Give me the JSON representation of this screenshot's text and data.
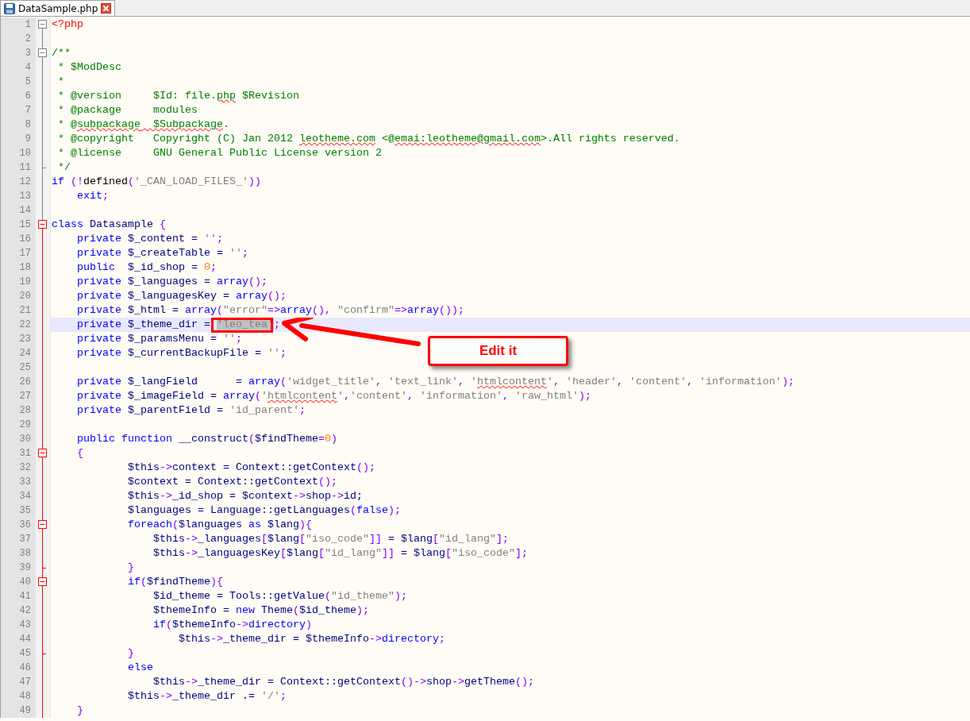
{
  "tabs": [
    {
      "label": "DataSample.php",
      "selected": true
    }
  ],
  "lines": [
    {
      "number": "1",
      "collapsible": true,
      "block_end": false,
      "active_block": false,
      "current": false,
      "tokens": [
        {
          "kind": "tag",
          "text": "<?php"
        }
      ]
    },
    {
      "number": "2",
      "collapsible": false,
      "block_end": false,
      "active_block": false,
      "current": false
    },
    {
      "number": "3",
      "collapsible": true,
      "block_end": false,
      "active_block": false,
      "current": false,
      "tokens": [
        {
          "kind": "comment",
          "text": "/**"
        }
      ]
    },
    {
      "number": "4",
      "collapsible": false,
      "block_end": false,
      "active_block": false,
      "current": false,
      "tokens": [
        {
          "kind": "comment",
          "text": " * $ModDesc"
        }
      ]
    },
    {
      "number": "5",
      "collapsible": false,
      "block_end": false,
      "active_block": false,
      "current": false,
      "tokens": [
        {
          "kind": "comment",
          "text": " *"
        }
      ]
    },
    {
      "number": "6",
      "collapsible": false,
      "block_end": false,
      "active_block": false,
      "current": false,
      "tokens": [
        {
          "kind": "comment",
          "text": " * @version     $Id: file."
        },
        {
          "kind": "comment-typo",
          "text": "php"
        },
        {
          "kind": "comment",
          "text": " $Revision"
        }
      ]
    },
    {
      "number": "7",
      "collapsible": false,
      "block_end": false,
      "active_block": false,
      "current": false,
      "tokens": [
        {
          "kind": "comment",
          "text": " * @package     modules"
        }
      ]
    },
    {
      "number": "8",
      "collapsible": false,
      "block_end": false,
      "active_block": false,
      "current": false,
      "tokens": [
        {
          "kind": "comment",
          "text": " * @"
        },
        {
          "kind": "comment-typo",
          "text": "subpackage"
        },
        {
          "kind": "comment-typo",
          "text": "  $Subpackage"
        },
        {
          "kind": "comment",
          "text": "."
        }
      ]
    },
    {
      "number": "9",
      "collapsible": false,
      "block_end": false,
      "active_block": false,
      "current": false,
      "tokens": [
        {
          "kind": "comment",
          "text": " * @copyright   Copyright (C) Jan 2012 "
        },
        {
          "kind": "comment-typo",
          "text": "leotheme.com"
        },
        {
          "kind": "comment",
          "text": " <@"
        },
        {
          "kind": "comment-typo",
          "text": "emai:leotheme@gmail.com"
        },
        {
          "kind": "comment",
          "text": ">.All rights reserved."
        }
      ]
    },
    {
      "number": "10",
      "collapsible": false,
      "block_end": false,
      "active_block": false,
      "current": false,
      "tokens": [
        {
          "kind": "comment",
          "text": " * @license     GNU General Public License version 2"
        }
      ]
    },
    {
      "number": "11",
      "collapsible": false,
      "block_end": true,
      "active_block": false,
      "current": false,
      "tokens": [
        {
          "kind": "comment",
          "text": " */"
        }
      ]
    },
    {
      "number": "12",
      "collapsible": false,
      "block_end": false,
      "active_block": false,
      "current": false,
      "tokens": [
        {
          "kind": "kw",
          "text": "if"
        },
        {
          "kind": "op",
          "text": " (!"
        },
        {
          "kind": "plain",
          "text": "defined"
        },
        {
          "kind": "op",
          "text": "("
        },
        {
          "kind": "str",
          "text": "'_CAN_LOAD_FILES_'"
        },
        {
          "kind": "op",
          "text": "))"
        }
      ]
    },
    {
      "number": "13",
      "collapsible": false,
      "block_end": false,
      "active_block": false,
      "current": false,
      "tokens": [
        {
          "kind": "kw",
          "text": "    exit"
        },
        {
          "kind": "op",
          "text": ";"
        }
      ]
    },
    {
      "number": "14",
      "collapsible": false,
      "block_end": false,
      "active_block": false,
      "current": false
    },
    {
      "number": "15",
      "collapsible": true,
      "block_end": false,
      "active_block": true,
      "current": false,
      "tokens": [
        {
          "kind": "kw",
          "text": "class"
        },
        {
          "kind": "var",
          "text": " Datasample "
        },
        {
          "kind": "op",
          "text": "{"
        }
      ]
    },
    {
      "number": "16",
      "collapsible": false,
      "block_end": false,
      "active_block": true,
      "current": false,
      "tokens": [
        {
          "kind": "kw",
          "text": "    private"
        },
        {
          "kind": "var",
          "text": " $_content = "
        },
        {
          "kind": "str",
          "text": "''"
        },
        {
          "kind": "op",
          "text": ";"
        }
      ]
    },
    {
      "number": "17",
      "collapsible": false,
      "block_end": false,
      "active_block": true,
      "current": false,
      "tokens": [
        {
          "kind": "kw",
          "text": "    private"
        },
        {
          "kind": "var",
          "text": " $_createTable = "
        },
        {
          "kind": "str",
          "text": "''"
        },
        {
          "kind": "op",
          "text": ";"
        }
      ]
    },
    {
      "number": "18",
      "collapsible": false,
      "block_end": false,
      "active_block": true,
      "current": false,
      "tokens": [
        {
          "kind": "kw",
          "text": "    public"
        },
        {
          "kind": "var",
          "text": "  $_id_shop = "
        },
        {
          "kind": "num",
          "text": "0"
        },
        {
          "kind": "op",
          "text": ";"
        }
      ]
    },
    {
      "number": "19",
      "collapsible": false,
      "block_end": false,
      "active_block": true,
      "current": false,
      "tokens": [
        {
          "kind": "kw",
          "text": "    private"
        },
        {
          "kind": "var",
          "text": " $_languages = "
        },
        {
          "kind": "kw",
          "text": "array"
        },
        {
          "kind": "op",
          "text": "();"
        }
      ]
    },
    {
      "number": "20",
      "collapsible": false,
      "block_end": false,
      "active_block": true,
      "current": false,
      "tokens": [
        {
          "kind": "kw",
          "text": "    private"
        },
        {
          "kind": "var",
          "text": " $_languagesKey = "
        },
        {
          "kind": "kw",
          "text": "array"
        },
        {
          "kind": "op",
          "text": "();"
        }
      ]
    },
    {
      "number": "21",
      "collapsible": false,
      "block_end": false,
      "active_block": true,
      "current": false,
      "tokens": [
        {
          "kind": "kw",
          "text": "    private"
        },
        {
          "kind": "var",
          "text": " $_html = "
        },
        {
          "kind": "kw",
          "text": "array"
        },
        {
          "kind": "op",
          "text": "("
        },
        {
          "kind": "str",
          "text": "\"error\""
        },
        {
          "kind": "op",
          "text": "=>"
        },
        {
          "kind": "kw",
          "text": "array"
        },
        {
          "kind": "op",
          "text": "(), "
        },
        {
          "kind": "str",
          "text": "\"confirm\""
        },
        {
          "kind": "op",
          "text": "=>"
        },
        {
          "kind": "kw",
          "text": "array"
        },
        {
          "kind": "op",
          "text": "());"
        }
      ]
    },
    {
      "number": "22",
      "collapsible": false,
      "block_end": false,
      "active_block": true,
      "current": true,
      "tokens": [
        {
          "kind": "kw",
          "text": "    private"
        },
        {
          "kind": "var",
          "text": " $_theme_dir = "
        },
        {
          "kind": "str-selected",
          "text": "'leo_tea'"
        },
        {
          "kind": "op",
          "text": ";"
        }
      ]
    },
    {
      "number": "23",
      "collapsible": false,
      "block_end": false,
      "active_block": true,
      "current": false,
      "tokens": [
        {
          "kind": "kw",
          "text": "    private"
        },
        {
          "kind": "var",
          "text": " $_paramsMenu = "
        },
        {
          "kind": "str",
          "text": "''"
        },
        {
          "kind": "op",
          "text": ";"
        }
      ]
    },
    {
      "number": "24",
      "collapsible": false,
      "block_end": false,
      "active_block": true,
      "current": false,
      "tokens": [
        {
          "kind": "kw",
          "text": "    private"
        },
        {
          "kind": "var",
          "text": " $_currentBackupFile = "
        },
        {
          "kind": "str",
          "text": "''"
        },
        {
          "kind": "op",
          "text": ";"
        }
      ]
    },
    {
      "number": "25",
      "collapsible": false,
      "block_end": false,
      "active_block": true,
      "current": false
    },
    {
      "number": "26",
      "collapsible": false,
      "block_end": false,
      "active_block": true,
      "current": false,
      "tokens": [
        {
          "kind": "kw",
          "text": "    private"
        },
        {
          "kind": "var",
          "text": " $_langField      = "
        },
        {
          "kind": "kw",
          "text": "array"
        },
        {
          "kind": "op",
          "text": "("
        },
        {
          "kind": "str",
          "text": "'widget_title'"
        },
        {
          "kind": "op",
          "text": ", "
        },
        {
          "kind": "str",
          "text": "'text_link'"
        },
        {
          "kind": "op",
          "text": ", "
        },
        {
          "kind": "str",
          "text": "'"
        },
        {
          "kind": "str-typo",
          "text": "htmlcontent"
        },
        {
          "kind": "str",
          "text": "'"
        },
        {
          "kind": "op",
          "text": ", "
        },
        {
          "kind": "str",
          "text": "'header'"
        },
        {
          "kind": "op",
          "text": ", "
        },
        {
          "kind": "str",
          "text": "'content'"
        },
        {
          "kind": "op",
          "text": ", "
        },
        {
          "kind": "str",
          "text": "'information'"
        },
        {
          "kind": "op",
          "text": ");"
        }
      ]
    },
    {
      "number": "27",
      "collapsible": false,
      "block_end": false,
      "active_block": true,
      "current": false,
      "tokens": [
        {
          "kind": "kw",
          "text": "    private"
        },
        {
          "kind": "var",
          "text": " $_imageField = "
        },
        {
          "kind": "kw",
          "text": "array"
        },
        {
          "kind": "op",
          "text": "("
        },
        {
          "kind": "str",
          "text": "'"
        },
        {
          "kind": "str-typo",
          "text": "htmlcontent"
        },
        {
          "kind": "str",
          "text": "'"
        },
        {
          "kind": "op",
          "text": ","
        },
        {
          "kind": "str",
          "text": "'content'"
        },
        {
          "kind": "op",
          "text": ", "
        },
        {
          "kind": "str",
          "text": "'information'"
        },
        {
          "kind": "op",
          "text": ", "
        },
        {
          "kind": "str",
          "text": "'raw_html'"
        },
        {
          "kind": "op",
          "text": ");"
        }
      ]
    },
    {
      "number": "28",
      "collapsible": false,
      "block_end": false,
      "active_block": true,
      "current": false,
      "tokens": [
        {
          "kind": "kw",
          "text": "    private"
        },
        {
          "kind": "var",
          "text": " $_parentField = "
        },
        {
          "kind": "str",
          "text": "'id_parent'"
        },
        {
          "kind": "op",
          "text": ";"
        }
      ]
    },
    {
      "number": "29",
      "collapsible": false,
      "block_end": false,
      "active_block": true,
      "current": false
    },
    {
      "number": "30",
      "collapsible": false,
      "block_end": false,
      "active_block": true,
      "current": false,
      "tokens": [
        {
          "kind": "kw",
          "text": "    public function"
        },
        {
          "kind": "var",
          "text": " __construct"
        },
        {
          "kind": "op",
          "text": "("
        },
        {
          "kind": "var",
          "text": "$findTheme"
        },
        {
          "kind": "op",
          "text": "="
        },
        {
          "kind": "num",
          "text": "0"
        },
        {
          "kind": "op",
          "text": ")"
        }
      ]
    },
    {
      "number": "31",
      "collapsible": true,
      "block_end": false,
      "active_block": true,
      "current": false,
      "tokens": [
        {
          "kind": "op",
          "text": "    {"
        }
      ]
    },
    {
      "number": "32",
      "collapsible": false,
      "block_end": false,
      "active_block": true,
      "current": false,
      "tokens": [
        {
          "kind": "var",
          "text": "            $this"
        },
        {
          "kind": "op",
          "text": "->"
        },
        {
          "kind": "var",
          "text": "context = Context::getContext"
        },
        {
          "kind": "op",
          "text": "();"
        }
      ]
    },
    {
      "number": "33",
      "collapsible": false,
      "block_end": false,
      "active_block": true,
      "current": false,
      "tokens": [
        {
          "kind": "var",
          "text": "            $context = Context::getContext"
        },
        {
          "kind": "op",
          "text": "();"
        }
      ]
    },
    {
      "number": "34",
      "collapsible": false,
      "block_end": false,
      "active_block": true,
      "current": false,
      "tokens": [
        {
          "kind": "var",
          "text": "            $this"
        },
        {
          "kind": "op",
          "text": "->"
        },
        {
          "kind": "var",
          "text": "_id_shop = $context"
        },
        {
          "kind": "op",
          "text": "->"
        },
        {
          "kind": "var",
          "text": "shop"
        },
        {
          "kind": "op",
          "text": "->"
        },
        {
          "kind": "var",
          "text": "id;"
        }
      ]
    },
    {
      "number": "35",
      "collapsible": false,
      "block_end": false,
      "active_block": true,
      "current": false,
      "tokens": [
        {
          "kind": "var",
          "text": "            $languages = Language::getLanguages"
        },
        {
          "kind": "op",
          "text": "("
        },
        {
          "kind": "kw",
          "text": "false"
        },
        {
          "kind": "op",
          "text": ");"
        }
      ]
    },
    {
      "number": "36",
      "collapsible": true,
      "block_end": false,
      "active_block": true,
      "current": false,
      "tokens": [
        {
          "kind": "kw",
          "text": "            foreach"
        },
        {
          "kind": "op",
          "text": "("
        },
        {
          "kind": "var",
          "text": "$languages "
        },
        {
          "kind": "kw",
          "text": "as"
        },
        {
          "kind": "var",
          "text": " $lang"
        },
        {
          "kind": "op",
          "text": "){"
        }
      ]
    },
    {
      "number": "37",
      "collapsible": false,
      "block_end": false,
      "active_block": true,
      "current": false,
      "tokens": [
        {
          "kind": "var",
          "text": "                $this"
        },
        {
          "kind": "op",
          "text": "->"
        },
        {
          "kind": "var",
          "text": "_languages"
        },
        {
          "kind": "op",
          "text": "["
        },
        {
          "kind": "var",
          "text": "$lang"
        },
        {
          "kind": "op",
          "text": "["
        },
        {
          "kind": "str",
          "text": "\"iso_code\""
        },
        {
          "kind": "op",
          "text": "]]"
        },
        {
          "kind": "var",
          "text": " = $lang"
        },
        {
          "kind": "op",
          "text": "["
        },
        {
          "kind": "str",
          "text": "\"id_lang\""
        },
        {
          "kind": "op",
          "text": "];"
        }
      ]
    },
    {
      "number": "38",
      "collapsible": false,
      "block_end": false,
      "active_block": true,
      "current": false,
      "tokens": [
        {
          "kind": "var",
          "text": "                $this"
        },
        {
          "kind": "op",
          "text": "->"
        },
        {
          "kind": "var",
          "text": "_languagesKey"
        },
        {
          "kind": "op",
          "text": "["
        },
        {
          "kind": "var",
          "text": "$lang"
        },
        {
          "kind": "op",
          "text": "["
        },
        {
          "kind": "str",
          "text": "\"id_lang\""
        },
        {
          "kind": "op",
          "text": "]]"
        },
        {
          "kind": "var",
          "text": " = $lang"
        },
        {
          "kind": "op",
          "text": "["
        },
        {
          "kind": "str",
          "text": "\"iso_code\""
        },
        {
          "kind": "op",
          "text": "];"
        }
      ]
    },
    {
      "number": "39",
      "collapsible": false,
      "block_end": true,
      "active_block": true,
      "current": false,
      "tokens": [
        {
          "kind": "op",
          "text": "            }"
        }
      ]
    },
    {
      "number": "40",
      "collapsible": true,
      "block_end": false,
      "active_block": true,
      "current": false,
      "tokens": [
        {
          "kind": "kw",
          "text": "            if"
        },
        {
          "kind": "op",
          "text": "("
        },
        {
          "kind": "var",
          "text": "$findTheme"
        },
        {
          "kind": "op",
          "text": "){"
        }
      ]
    },
    {
      "number": "41",
      "collapsible": false,
      "block_end": false,
      "active_block": true,
      "current": false,
      "tokens": [
        {
          "kind": "var",
          "text": "                $id_theme = Tools::getValue"
        },
        {
          "kind": "op",
          "text": "("
        },
        {
          "kind": "str",
          "text": "\"id_theme\""
        },
        {
          "kind": "op",
          "text": ");"
        }
      ]
    },
    {
      "number": "42",
      "collapsible": false,
      "block_end": false,
      "active_block": true,
      "current": false,
      "tokens": [
        {
          "kind": "var",
          "text": "                $themeInfo = "
        },
        {
          "kind": "kw",
          "text": "new"
        },
        {
          "kind": "var",
          "text": " Theme"
        },
        {
          "kind": "op",
          "text": "("
        },
        {
          "kind": "var",
          "text": "$id_theme"
        },
        {
          "kind": "op",
          "text": ");"
        }
      ]
    },
    {
      "number": "43",
      "collapsible": false,
      "block_end": false,
      "active_block": true,
      "current": false,
      "tokens": [
        {
          "kind": "kw",
          "text": "                if"
        },
        {
          "kind": "op",
          "text": "("
        },
        {
          "kind": "var",
          "text": "$themeInfo"
        },
        {
          "kind": "op",
          "text": "->"
        },
        {
          "kind": "kw",
          "text": "directory"
        },
        {
          "kind": "op",
          "text": ")"
        }
      ]
    },
    {
      "number": "44",
      "collapsible": false,
      "block_end": false,
      "active_block": true,
      "current": false,
      "tokens": [
        {
          "kind": "var",
          "text": "                    $this"
        },
        {
          "kind": "op",
          "text": "->"
        },
        {
          "kind": "var",
          "text": "_theme_dir = $themeInfo"
        },
        {
          "kind": "op",
          "text": "->"
        },
        {
          "kind": "kw",
          "text": "directory"
        },
        {
          "kind": "op",
          "text": ";"
        }
      ]
    },
    {
      "number": "45",
      "collapsible": false,
      "block_end": true,
      "active_block": true,
      "current": false,
      "tokens": [
        {
          "kind": "op",
          "text": "            }"
        }
      ]
    },
    {
      "number": "46",
      "collapsible": false,
      "block_end": false,
      "active_block": true,
      "current": false,
      "tokens": [
        {
          "kind": "kw",
          "text": "            else"
        }
      ]
    },
    {
      "number": "47",
      "collapsible": false,
      "block_end": false,
      "active_block": true,
      "current": false,
      "tokens": [
        {
          "kind": "var",
          "text": "                $this"
        },
        {
          "kind": "op",
          "text": "->"
        },
        {
          "kind": "var",
          "text": "_theme_dir = Context::getContext"
        },
        {
          "kind": "op",
          "text": "()->"
        },
        {
          "kind": "var",
          "text": "shop"
        },
        {
          "kind": "op",
          "text": "->"
        },
        {
          "kind": "var",
          "text": "getTheme"
        },
        {
          "kind": "op",
          "text": "();"
        }
      ]
    },
    {
      "number": "48",
      "collapsible": false,
      "block_end": false,
      "active_block": true,
      "current": false,
      "tokens": [
        {
          "kind": "var",
          "text": "            $this"
        },
        {
          "kind": "op",
          "text": "->"
        },
        {
          "kind": "var",
          "text": "_theme_dir .= "
        },
        {
          "kind": "str",
          "text": "'/'"
        },
        {
          "kind": "op",
          "text": ";"
        }
      ]
    },
    {
      "number": "49",
      "collapsible": false,
      "block_end": false,
      "active_block": true,
      "current": false,
      "tokens": [
        {
          "kind": "op",
          "text": "    }"
        }
      ]
    }
  ],
  "annotation": {
    "callout": "Edit it"
  }
}
